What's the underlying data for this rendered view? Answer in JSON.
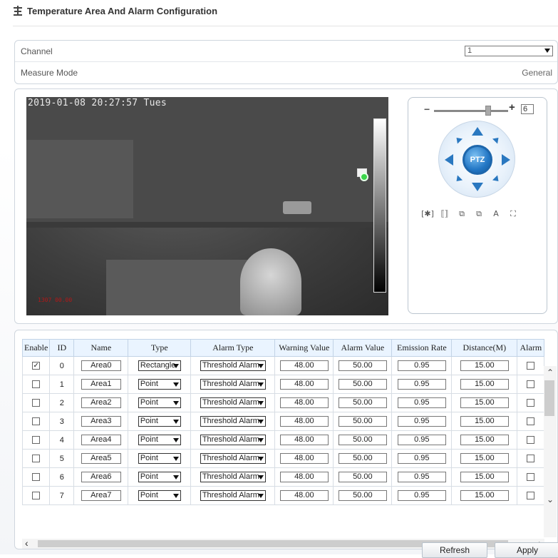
{
  "page": {
    "title": "Temperature Area And Alarm Configuration",
    "icon": "thermometer-settings-icon"
  },
  "settings": {
    "channel_label": "Channel",
    "channel_value": "1",
    "measure_mode_label": "Measure Mode",
    "measure_mode_value": "General"
  },
  "video": {
    "osd_time": "2019-01-08 20:27:57 Tues",
    "osd_corner": "1307 00.00"
  },
  "ptz": {
    "zoom_value": "6",
    "zoom_minus": "−",
    "zoom_plus": "+",
    "center_label": "PTZ",
    "tools": [
      "[✱]",
      "⟦⟧",
      "⧉",
      "⧉",
      "A",
      "⛶"
    ]
  },
  "table": {
    "headers": [
      "Enable",
      "ID",
      "Name",
      "Type",
      "Alarm Type",
      "Warning Value",
      "Alarm Value",
      "Emission Rate",
      "Distance(M)",
      "Alarm"
    ],
    "rows": [
      {
        "enable": true,
        "id": "0",
        "name": "Area0",
        "type": "Rectangle",
        "alarm_type": "Threshold Alarm",
        "warning": "48.00",
        "alarm_value": "50.00",
        "emission": "0.95",
        "distance": "15.00",
        "alarm": false
      },
      {
        "enable": false,
        "id": "1",
        "name": "Area1",
        "type": "Point",
        "alarm_type": "Threshold Alarm",
        "warning": "48.00",
        "alarm_value": "50.00",
        "emission": "0.95",
        "distance": "15.00",
        "alarm": false
      },
      {
        "enable": false,
        "id": "2",
        "name": "Area2",
        "type": "Point",
        "alarm_type": "Threshold Alarm",
        "warning": "48.00",
        "alarm_value": "50.00",
        "emission": "0.95",
        "distance": "15.00",
        "alarm": false
      },
      {
        "enable": false,
        "id": "3",
        "name": "Area3",
        "type": "Point",
        "alarm_type": "Threshold Alarm",
        "warning": "48.00",
        "alarm_value": "50.00",
        "emission": "0.95",
        "distance": "15.00",
        "alarm": false
      },
      {
        "enable": false,
        "id": "4",
        "name": "Area4",
        "type": "Point",
        "alarm_type": "Threshold Alarm",
        "warning": "48.00",
        "alarm_value": "50.00",
        "emission": "0.95",
        "distance": "15.00",
        "alarm": false
      },
      {
        "enable": false,
        "id": "5",
        "name": "Area5",
        "type": "Point",
        "alarm_type": "Threshold Alarm",
        "warning": "48.00",
        "alarm_value": "50.00",
        "emission": "0.95",
        "distance": "15.00",
        "alarm": false
      },
      {
        "enable": false,
        "id": "6",
        "name": "Area6",
        "type": "Point",
        "alarm_type": "Threshold Alarm",
        "warning": "48.00",
        "alarm_value": "50.00",
        "emission": "0.95",
        "distance": "15.00",
        "alarm": false
      },
      {
        "enable": false,
        "id": "7",
        "name": "Area7",
        "type": "Point",
        "alarm_type": "Threshold Alarm",
        "warning": "48.00",
        "alarm_value": "50.00",
        "emission": "0.95",
        "distance": "15.00",
        "alarm": false
      }
    ]
  },
  "buttons": {
    "refresh": "Refresh",
    "apply": "Apply"
  },
  "colors": {
    "header_bg": "#eaf4ff",
    "ptz_blue": "#2377c5",
    "target_green": "#3bd54a"
  }
}
